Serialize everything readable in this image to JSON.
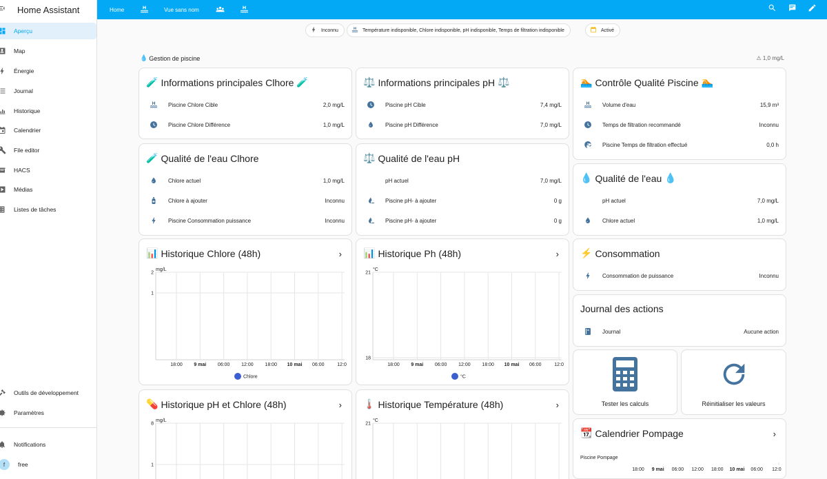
{
  "app": {
    "title": "Home Assistant"
  },
  "sidebar": {
    "items": [
      {
        "label": "Aperçu",
        "icon": "dashboard-icon",
        "active": true
      },
      {
        "label": "Map",
        "icon": "map-icon"
      },
      {
        "label": "Énergie",
        "icon": "lightning-icon"
      },
      {
        "label": "Journal",
        "icon": "list-icon"
      },
      {
        "label": "Historique",
        "icon": "chart-icon"
      },
      {
        "label": "Calendrier",
        "icon": "calendar-icon"
      },
      {
        "label": "File editor",
        "icon": "wrench-icon"
      },
      {
        "label": "HACS",
        "icon": "hacs-icon"
      },
      {
        "label": "Médias",
        "icon": "media-icon"
      },
      {
        "label": "Listes de tâches",
        "icon": "checklist-icon"
      }
    ],
    "bottom": [
      {
        "label": "Outils de développement",
        "icon": "hammer-icon"
      },
      {
        "label": "Paramètres",
        "icon": "gear-icon"
      }
    ],
    "notifications": "Notifications",
    "user": {
      "name": "free",
      "initial": "f"
    }
  },
  "topbar": {
    "tabs": [
      {
        "label": "Home"
      },
      {
        "label": "",
        "icon": "pool-icon"
      },
      {
        "label": "Vue sans nom"
      },
      {
        "label": "",
        "icon": "people-icon"
      },
      {
        "label": "",
        "icon": "pool-icon"
      }
    ],
    "actions": [
      "search-icon",
      "chat-icon",
      "pencil-icon"
    ]
  },
  "badges": [
    {
      "text": "Inconnu",
      "icon": "lightning-icon"
    },
    {
      "text": "Température indisponible, Chlore indisponible, pH indisponible, Temps de filtration indisponible",
      "icon": "pool-icon"
    },
    {
      "text": "Activé",
      "icon": "calendar-icon"
    }
  ],
  "section": {
    "title": "Gestion de piscine",
    "right": "⚠ 1,0 mg/L"
  },
  "cards": {
    "chlore_info": {
      "title": "Informations principales Clhore",
      "emoji": "🧪",
      "rows": [
        {
          "name": "Piscine Chlore Cible",
          "value": "2,0 mg/L",
          "icon": "pool-icon"
        },
        {
          "name": "Piscine Chlore Différence",
          "value": "1,0 mg/L",
          "icon": "clock-icon"
        }
      ]
    },
    "ph_info": {
      "title": "Informations principales pH",
      "emoji": "⚖️",
      "rows": [
        {
          "name": "Piscine pH Cible",
          "value": "7,4 mg/L",
          "icon": "clock-icon"
        },
        {
          "name": "Piscine pH Différence",
          "value": "7,0 mg/L",
          "icon": "water-icon"
        }
      ]
    },
    "quality": {
      "title": "Contrôle Qualité Piscine",
      "emoji": "🏊",
      "rows": [
        {
          "name": "Volume d'eau",
          "value": "15,9 m³",
          "icon": "pool-icon"
        },
        {
          "name": "Temps de filtration recommandé",
          "value": "Inconnu",
          "icon": "clock-icon"
        },
        {
          "name": "Piscine Temps de filtration effectué",
          "value": "0,0 h",
          "icon": "clock-check-icon"
        }
      ]
    },
    "chlore_quality": {
      "title": "Qualité de l'eau Clhore",
      "emoji": "🧪",
      "rows": [
        {
          "name": "Chlore actuel",
          "value": "1,0 mg/L",
          "icon": "water-icon"
        },
        {
          "name": "Chlore à ajouter",
          "value": "Inconnu",
          "icon": "bottle-icon"
        },
        {
          "name": "Piscine Consommation puissance",
          "value": "Inconnu",
          "icon": "lightning-icon"
        }
      ]
    },
    "ph_quality": {
      "title": "Qualité de l'eau pH",
      "emoji": "⚖️",
      "rows": [
        {
          "name": "pH actuel",
          "value": "7,0 mg/L",
          "icon": ""
        },
        {
          "name": "Piscine pH- à ajouter",
          "value": "0 g",
          "icon": "water-minus-icon"
        },
        {
          "name": "Piscine pH- à ajouter",
          "value": "0 g",
          "icon": "water-minus-icon"
        }
      ]
    },
    "water": {
      "title": "Qualité de l'eau",
      "emoji": "💧",
      "rows": [
        {
          "name": "pH actuel",
          "value": "7,0 mg/L",
          "icon": ""
        },
        {
          "name": "Chlore actuel",
          "value": "1,0 mg/L",
          "icon": "water-icon"
        }
      ]
    },
    "consumption": {
      "title": "Consommation",
      "emoji": "⚡",
      "rows": [
        {
          "name": "Consommation de puissance",
          "value": "Inconnu",
          "icon": "lightning-icon"
        }
      ]
    },
    "journal": {
      "title": "Journal des actions",
      "rows": [
        {
          "name": "Journal",
          "value": "Aucune action",
          "icon": "notebook-icon"
        }
      ]
    },
    "btn_test": {
      "label": "Tester les calculs",
      "icon": "calculator-icon"
    },
    "btn_reset": {
      "label": "Réinitialiser les valeurs",
      "icon": "refresh-icon"
    },
    "calendar": {
      "title": "Calendrier Pompage",
      "emoji": "📆",
      "row_label": "Piscine Pompage",
      "ticks": [
        "18:00",
        "9 mai",
        "06:00",
        "12:00",
        "18:00",
        "10 mai",
        "06:00",
        "12:0"
      ]
    }
  },
  "chart_data": [
    {
      "type": "line",
      "title": "Historique Chlore (48h)",
      "emoji": "📊",
      "unit": "mg/L",
      "ylim": [
        0,
        2
      ],
      "yticks": [
        "2",
        "1"
      ],
      "xticks": [
        "18:00",
        "9 mai",
        "06:00",
        "12:00",
        "18:00",
        "10 mai",
        "06:00",
        "12:0"
      ],
      "series": [
        {
          "name": "Chlore",
          "color": "#3b5fd0",
          "values": []
        }
      ]
    },
    {
      "type": "line",
      "title": "Historique Ph (48h)",
      "emoji": "📊",
      "unit": "°C",
      "ylim": [
        18,
        21
      ],
      "yticks": [
        "21",
        "18"
      ],
      "xticks": [
        "18:00",
        "9 mai",
        "06:00",
        "12:00",
        "18:00",
        "10 mai",
        "06:00",
        "12:0"
      ],
      "series": [
        {
          "name": "°C",
          "color": "#3b5fd0",
          "values": []
        }
      ]
    },
    {
      "type": "line",
      "title": "Historique pH et Chlore (48h)",
      "emoji": "💊",
      "unit": "mg/L",
      "yticks": [
        "8",
        "1"
      ],
      "series": []
    },
    {
      "type": "line",
      "title": "Historique Température (48h)",
      "emoji": "🌡️",
      "unit": "°C",
      "yticks": [
        "21"
      ],
      "series": []
    }
  ]
}
